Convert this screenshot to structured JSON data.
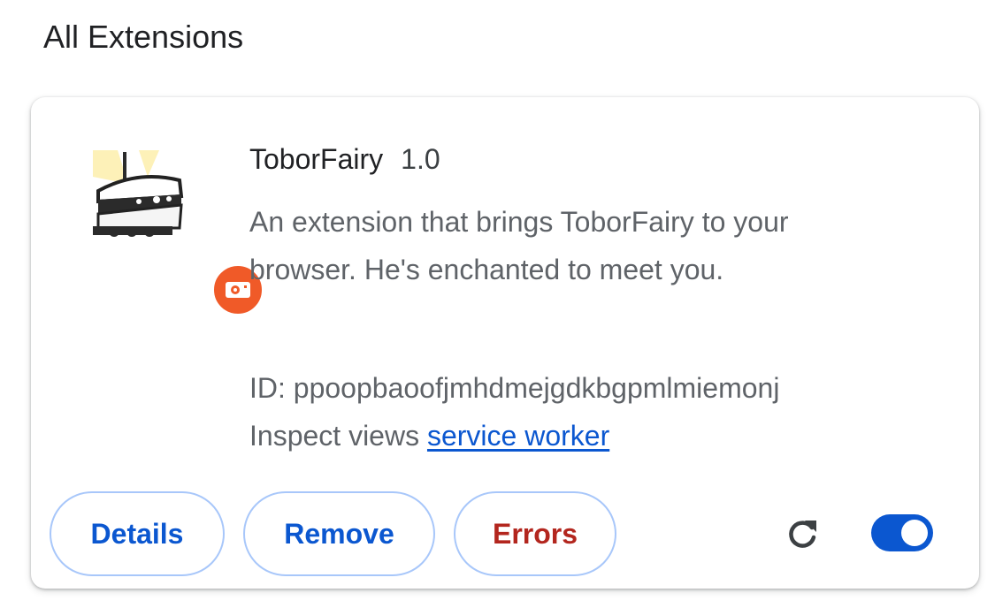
{
  "section": {
    "title": "All Extensions"
  },
  "extension": {
    "icon": "toborfairy-robot-icon",
    "badge_icon": "unpacked-extension-badge-icon",
    "name": "ToborFairy",
    "version": "1.0",
    "description": "An extension that brings ToborFairy to your browser. He's enchanted to meet you.",
    "id_label": "ID: ppoopbaoofjmhdmejgdkbgpmlmiemonj",
    "inspect_label": "Inspect views",
    "inspect_link": "service worker",
    "enabled": true
  },
  "actions": {
    "details_label": "Details",
    "remove_label": "Remove",
    "errors_label": "Errors",
    "reload_icon": "reload-icon"
  },
  "colors": {
    "accent": "#0b57d0",
    "error": "#b3261e",
    "badge": "#f05a28",
    "button_border": "#a8c7fa"
  }
}
